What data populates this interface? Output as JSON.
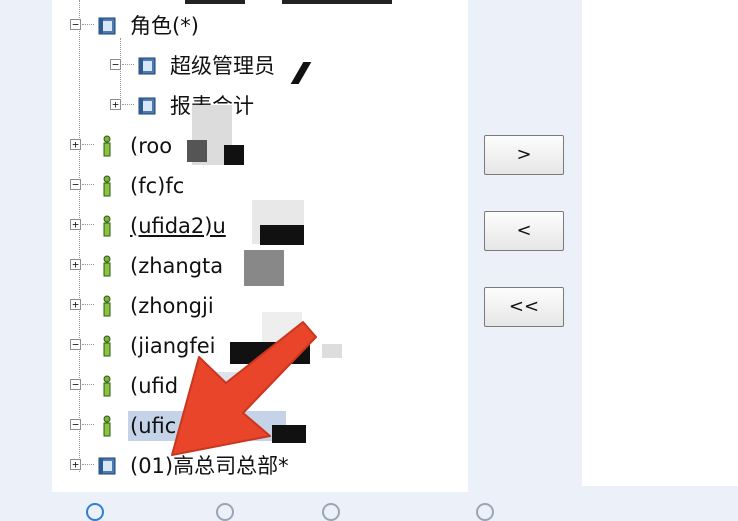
{
  "tree": {
    "nodes": [
      {
        "label": "角色(*)",
        "expander": "minus",
        "icon": "role-folder-icon",
        "selected": false,
        "underline": false
      },
      {
        "label": "超级管理员",
        "expander": "minus",
        "icon": "role-folder-icon",
        "selected": false,
        "underline": false
      },
      {
        "label": "报表会计",
        "expander": "plus",
        "icon": "role-folder-icon",
        "selected": false,
        "underline": false
      },
      {
        "label": "(roo",
        "expander": "plus",
        "icon": "user-icon",
        "selected": false,
        "underline": false
      },
      {
        "label": "(fc)fc",
        "expander": "minus",
        "icon": "user-icon",
        "selected": false,
        "underline": false
      },
      {
        "label": "(ufida2)u",
        "expander": "plus",
        "icon": "user-icon",
        "selected": false,
        "underline": true
      },
      {
        "label": "(zhangta",
        "expander": "plus",
        "icon": "user-icon",
        "selected": false,
        "underline": false
      },
      {
        "label": "(zhongji",
        "expander": "plus",
        "icon": "user-icon",
        "selected": false,
        "underline": false
      },
      {
        "label": "(jiangfei",
        "expander": "minus",
        "icon": "user-icon",
        "selected": false,
        "underline": false
      },
      {
        "label": "(ufid",
        "expander": "minus",
        "icon": "user-icon",
        "selected": false,
        "underline": false
      },
      {
        "label": "(ufic",
        "expander": "minus",
        "icon": "user-icon",
        "selected": true,
        "underline": false
      },
      {
        "label": "(01)高总司总部*",
        "expander": "plus",
        "icon": "org-folder-icon",
        "selected": false,
        "underline": false
      }
    ]
  },
  "buttons": {
    "add_label": ">",
    "remove_label": "<",
    "remove_all_label": "<<"
  },
  "colors": {
    "background": "#ebf0f9",
    "selection": "#c4d3e8",
    "annotation_arrow": "#e8452a"
  }
}
